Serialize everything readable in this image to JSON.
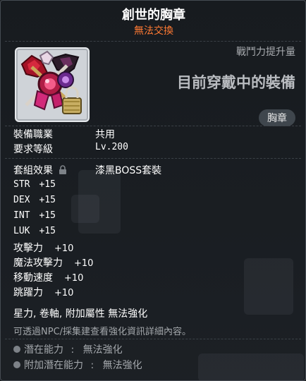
{
  "item": {
    "name": "創世的胸章",
    "trade_status": "無法交換"
  },
  "power_label": "戰鬥力提升量",
  "equipped_label": "目前穿戴中的裝備",
  "category": "胸章",
  "requirements": [
    {
      "label": "裝備職業",
      "value": "共用"
    },
    {
      "label": "要求等級",
      "value": "Lv.200"
    }
  ],
  "set_effect": {
    "label": "套組效果",
    "value": "漆黑BOSS套裝"
  },
  "stats": [
    {
      "name": "STR",
      "value": "+15"
    },
    {
      "name": "DEX",
      "value": "+15"
    },
    {
      "name": "INT",
      "value": "+15"
    },
    {
      "name": "LUK",
      "value": "+15"
    },
    {
      "name": "攻擊力",
      "value": "+10"
    },
    {
      "name": "魔法攻擊力",
      "value": "+10"
    },
    {
      "name": "移動速度",
      "value": "+10"
    },
    {
      "name": "跳躍力",
      "value": "+10"
    }
  ],
  "enhance_note": "星力, 卷軸, 附加屬性 無法強化",
  "info_note": "可透過NPC/採集建查看強化資訊詳細內容。",
  "potential": {
    "label": "潛在能力",
    "value": "無法強化"
  },
  "additional_potential": {
    "label": "附加潛在能力",
    "value": "無法強化"
  },
  "colors": {
    "name": "#ffffff",
    "trade": "#ff7a33",
    "muted": "#a3a7ab",
    "panel": "#1c2025"
  }
}
